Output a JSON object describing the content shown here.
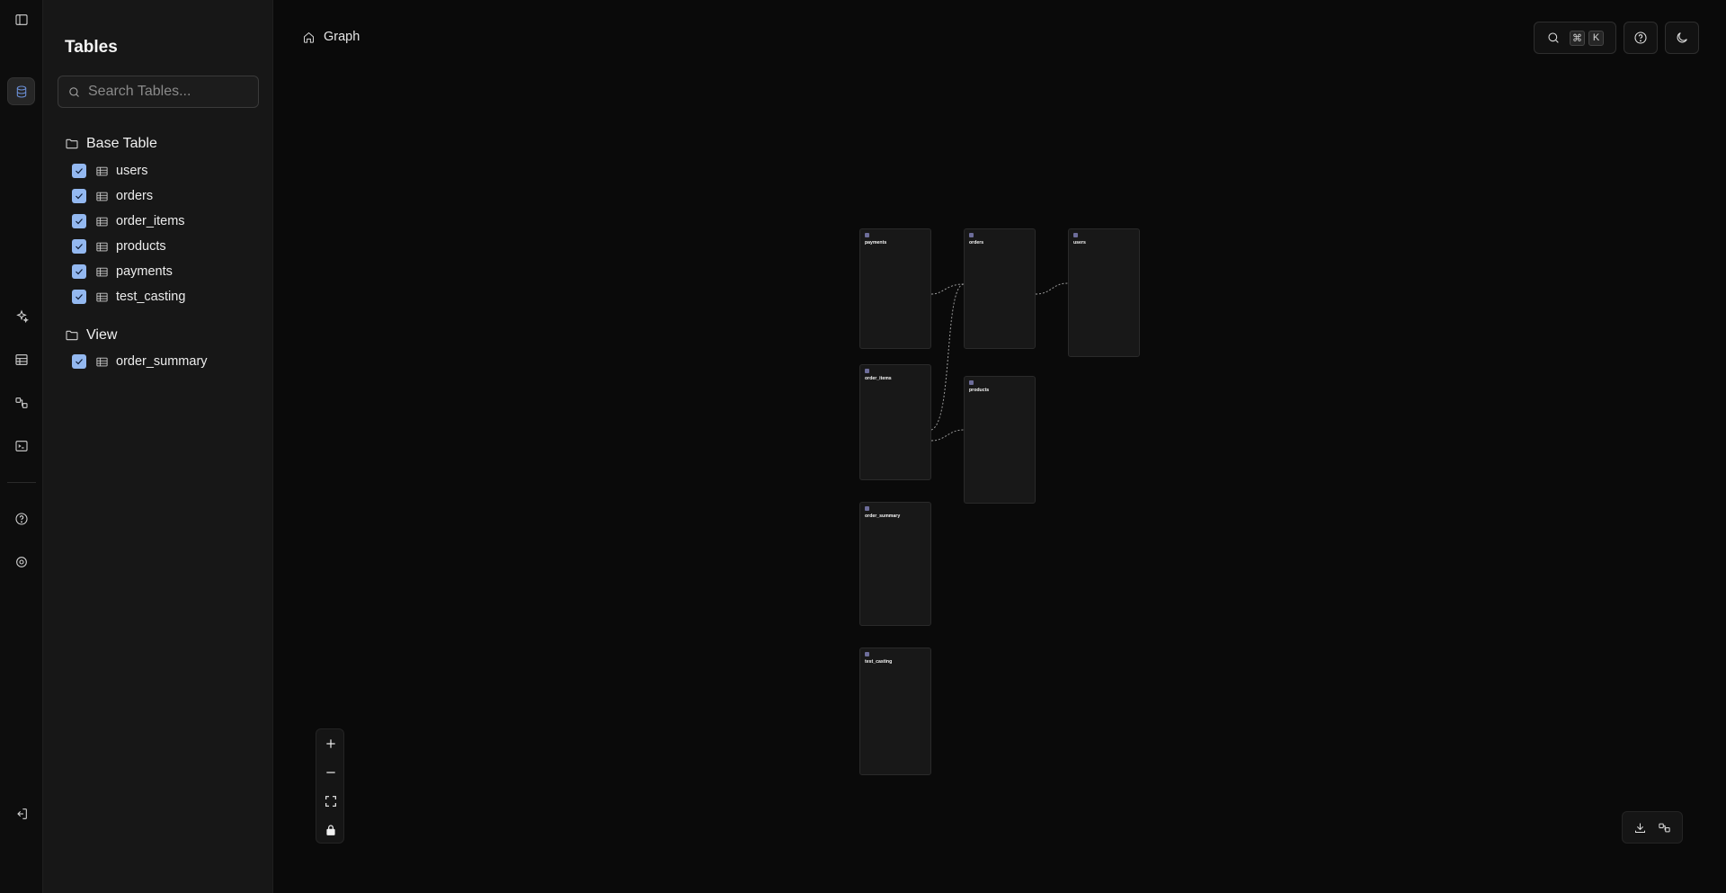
{
  "sidebar": {
    "title": "Tables",
    "search_placeholder": "Search Tables...",
    "groups": [
      {
        "label": "Base Table",
        "items": [
          "users",
          "orders",
          "order_items",
          "products",
          "payments",
          "test_casting"
        ]
      },
      {
        "label": "View",
        "items": [
          "order_summary"
        ]
      }
    ]
  },
  "breadcrumb": {
    "label": "Graph"
  },
  "search_shortcut": {
    "mod": "⌘",
    "key": "K"
  },
  "rail_icons": [
    "sidebar-toggle-icon",
    "database-icon",
    "sparkles-icon",
    "table-icon",
    "schema-icon",
    "terminal-icon",
    "help-icon",
    "settings-icon",
    "logout-icon"
  ],
  "colors": {
    "checkbox": "#93b8f0",
    "background": "#0a0a0a",
    "sidebar": "#171717"
  }
}
